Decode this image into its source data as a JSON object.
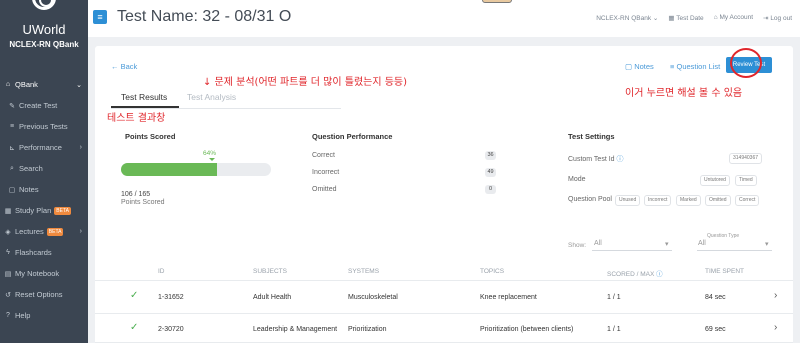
{
  "sidebar": {
    "brand": "UWorld",
    "subtitle": "NCLEX-RN QBank",
    "items": [
      {
        "icon": "bank-icon",
        "label": "QBank"
      },
      {
        "icon": "edit-icon",
        "label": "Create Test"
      },
      {
        "icon": "list-icon",
        "label": "Previous Tests"
      },
      {
        "icon": "chart-icon",
        "label": "Performance"
      },
      {
        "icon": "search-icon",
        "label": "Search"
      },
      {
        "icon": "note-icon",
        "label": "Notes"
      },
      {
        "icon": "calendar-icon",
        "label": "Study Plan",
        "badge": "BETA"
      },
      {
        "icon": "lectures-icon",
        "label": "Lectures",
        "badge": "BETA"
      },
      {
        "icon": "flash-icon",
        "label": "Flashcards"
      },
      {
        "icon": "notebook-icon",
        "label": "My Notebook"
      },
      {
        "icon": "reset-icon",
        "label": "Reset Options"
      },
      {
        "icon": "help-icon",
        "label": "Help"
      }
    ]
  },
  "header": {
    "title": "Test Name: 32 - 08/31 O",
    "qbank": "NCLEX-RN QBank",
    "test_date": "Test Date",
    "my_account": "My Account",
    "logout": "Log out"
  },
  "toolbar": {
    "back": "← Back",
    "notes": "Notes",
    "question_list": "Question List",
    "review_test": "Review Test"
  },
  "tabs": {
    "results": "Test Results",
    "analysis": "Test Analysis"
  },
  "annotations": {
    "analysis_note": "↓ 문제 분석(어떤 파트를 더 많이 틀렸는지 등등)",
    "results_note": "테스트 결과창",
    "review_note": "이거 누르면 해설 볼 수 있음"
  },
  "points": {
    "title": "Points Scored",
    "percent": "64%",
    "fraction": 0.64,
    "score": "106 / 165",
    "score_label": "Points Scored"
  },
  "performance": {
    "title": "Question Performance",
    "rows": [
      {
        "label": "Correct",
        "value": "36"
      },
      {
        "label": "Incorrect",
        "value": "49"
      },
      {
        "label": "Omitted",
        "value": "0"
      }
    ]
  },
  "settings": {
    "title": "Test Settings",
    "custom_id_label": "Custom Test Id",
    "custom_id": "314940367",
    "mode_label": "Mode",
    "modes": [
      "Untutored",
      "Timed"
    ],
    "pool_label": "Question Pool",
    "pools": [
      "Unused",
      "Incorrect",
      "Marked",
      "Omitted",
      "Correct"
    ]
  },
  "filters": {
    "show_label": "Show:",
    "show_value": "All",
    "type_label": "Question Type",
    "type_value": "All"
  },
  "table": {
    "headers": [
      "ID",
      "SUBJECTS",
      "SYSTEMS",
      "TOPICS",
      "SCORED / MAX",
      "TIME SPENT"
    ],
    "rows": [
      {
        "id": "1-31652",
        "subject": "Adult Health",
        "system": "Musculoskeletal",
        "topic": "Knee replacement",
        "score": "1 / 1",
        "time": "84 sec"
      },
      {
        "id": "2-30720",
        "subject": "Leadership & Management",
        "system": "Prioritization",
        "topic": "Prioritization (between clients)",
        "score": "1 / 1",
        "time": "69 sec"
      }
    ]
  },
  "colors": {
    "accent": "#2d8fd5",
    "success": "#6ab956",
    "annotation": "#e0262b",
    "sidebar": "#3b4552"
  }
}
